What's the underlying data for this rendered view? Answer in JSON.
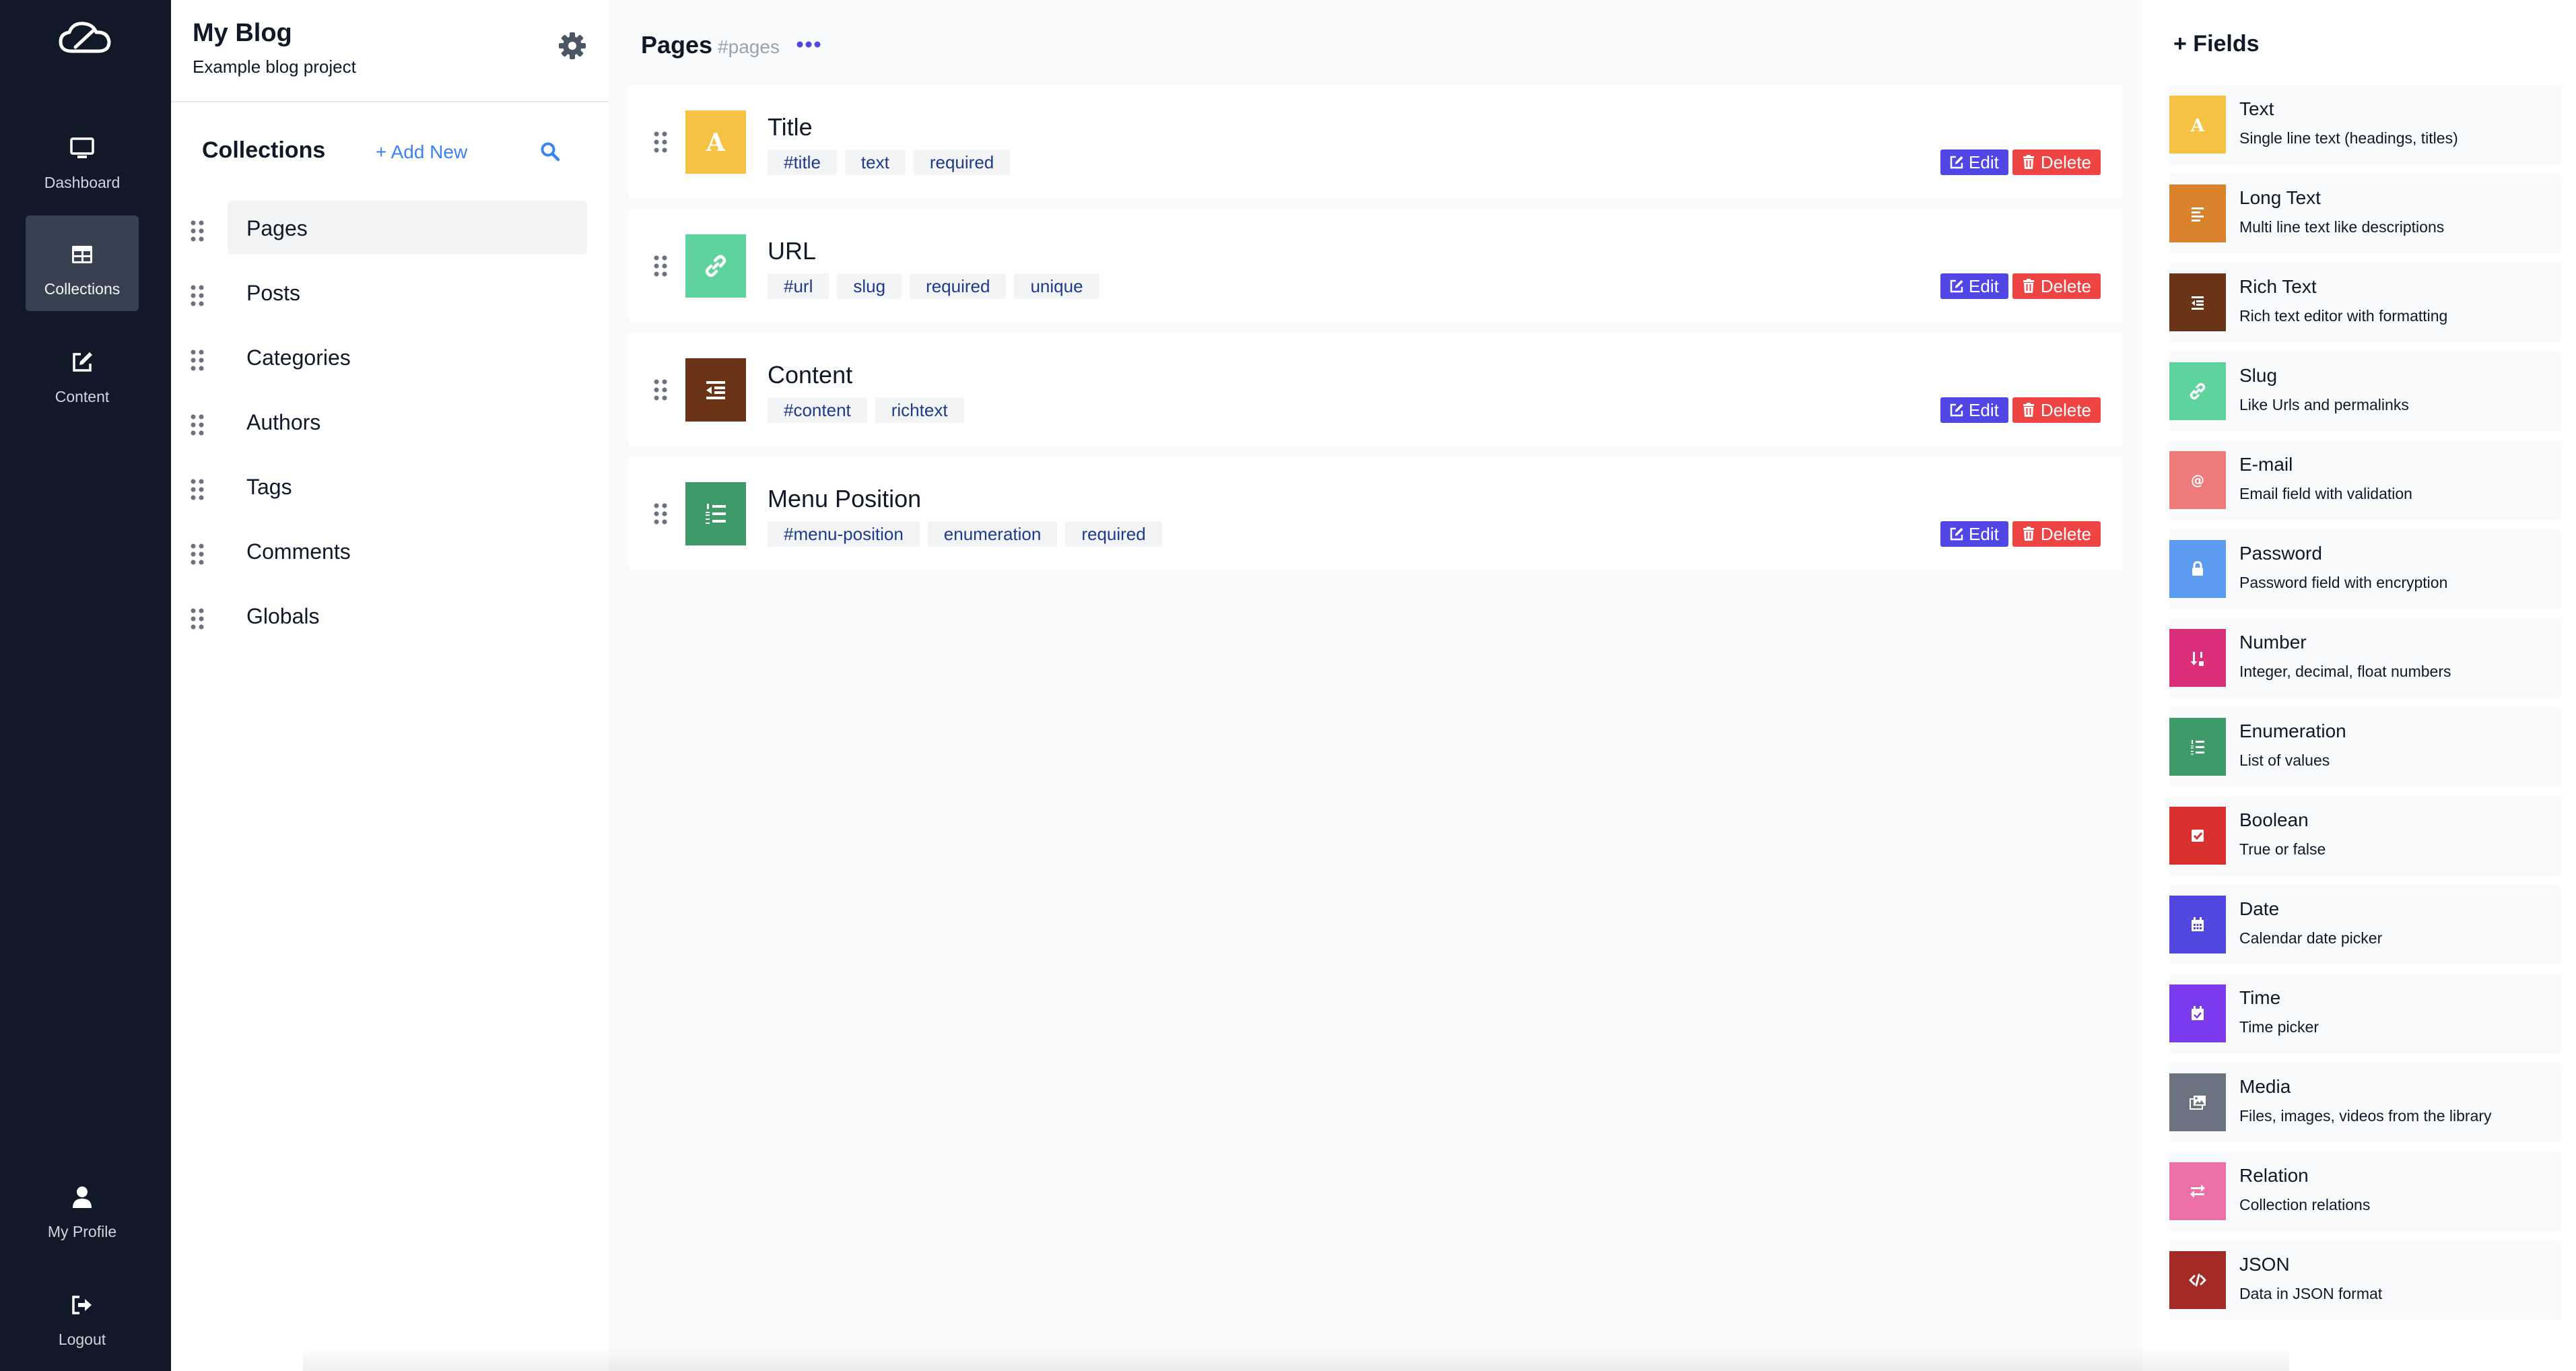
{
  "nav": {
    "items": [
      {
        "label": "Dashboard",
        "icon": "monitor-icon"
      },
      {
        "label": "Collections",
        "icon": "table-icon",
        "active": true
      },
      {
        "label": "Content",
        "icon": "edit-icon"
      }
    ],
    "bottom": [
      {
        "label": "My Profile",
        "icon": "user-icon"
      },
      {
        "label": "Logout",
        "icon": "logout-icon"
      }
    ]
  },
  "project": {
    "title": "My Blog",
    "subtitle": "Example blog project"
  },
  "collections": {
    "heading": "Collections",
    "add_label": "+ Add New",
    "items": [
      {
        "label": "Pages",
        "active": true
      },
      {
        "label": "Posts"
      },
      {
        "label": "Categories"
      },
      {
        "label": "Authors"
      },
      {
        "label": "Tags"
      },
      {
        "label": "Comments"
      },
      {
        "label": "Globals"
      }
    ]
  },
  "main": {
    "title": "Pages",
    "slug": "#pages",
    "edit_label": "Edit",
    "delete_label": "Delete",
    "fields": [
      {
        "name": "Title",
        "icon": "letter-a-icon",
        "color": "#f6c244",
        "tags": [
          "#title",
          "text",
          "required"
        ]
      },
      {
        "name": "URL",
        "icon": "link-icon",
        "color": "#5ed39e",
        "tags": [
          "#url",
          "slug",
          "required",
          "unique"
        ]
      },
      {
        "name": "Content",
        "icon": "rich-text-icon",
        "color": "#6b3416",
        "tags": [
          "#content",
          "richtext"
        ]
      },
      {
        "name": "Menu Position",
        "icon": "list-ol-icon",
        "color": "#3f9a6a",
        "tags": [
          "#menu-position",
          "enumeration",
          "required"
        ]
      }
    ]
  },
  "field_types": {
    "title": "+ Fields",
    "items": [
      {
        "name": "Text",
        "desc": "Single line text (headings, titles)",
        "color": "#f6c244",
        "icon": "letter-a-icon"
      },
      {
        "name": "Long Text",
        "desc": "Multi line text like descriptions",
        "color": "#d9822b",
        "icon": "align-left-icon"
      },
      {
        "name": "Rich Text",
        "desc": "Rich text editor with formatting",
        "color": "#6b3416",
        "icon": "rich-text-icon"
      },
      {
        "name": "Slug",
        "desc": "Like Urls and permalinks",
        "color": "#5ed39e",
        "icon": "link-icon"
      },
      {
        "name": "E-mail",
        "desc": "Email field with validation",
        "color": "#ef7a7a",
        "icon": "at-icon"
      },
      {
        "name": "Password",
        "desc": "Password field with encryption",
        "color": "#5b9bf0",
        "icon": "lock-icon"
      },
      {
        "name": "Number",
        "desc": "Integer, decimal, float numbers",
        "color": "#db2f7b",
        "icon": "sort-numeric-icon"
      },
      {
        "name": "Enumeration",
        "desc": "List of values",
        "color": "#3f9a6a",
        "icon": "list-ol-icon"
      },
      {
        "name": "Boolean",
        "desc": "True or false",
        "color": "#d93030",
        "icon": "check-square-icon"
      },
      {
        "name": "Date",
        "desc": "Calendar date picker",
        "color": "#5046e0",
        "icon": "calendar-icon"
      },
      {
        "name": "Time",
        "desc": "Time picker",
        "color": "#7c3aed",
        "icon": "calendar-check-icon"
      },
      {
        "name": "Media",
        "desc": "Files, images, videos from the library",
        "color": "#6b7280",
        "icon": "images-icon"
      },
      {
        "name": "Relation",
        "desc": "Collection relations",
        "color": "#ec6fa8",
        "icon": "exchange-icon"
      },
      {
        "name": "JSON",
        "desc": "Data in JSON format",
        "color": "#a42a26",
        "icon": "code-icon"
      }
    ]
  }
}
